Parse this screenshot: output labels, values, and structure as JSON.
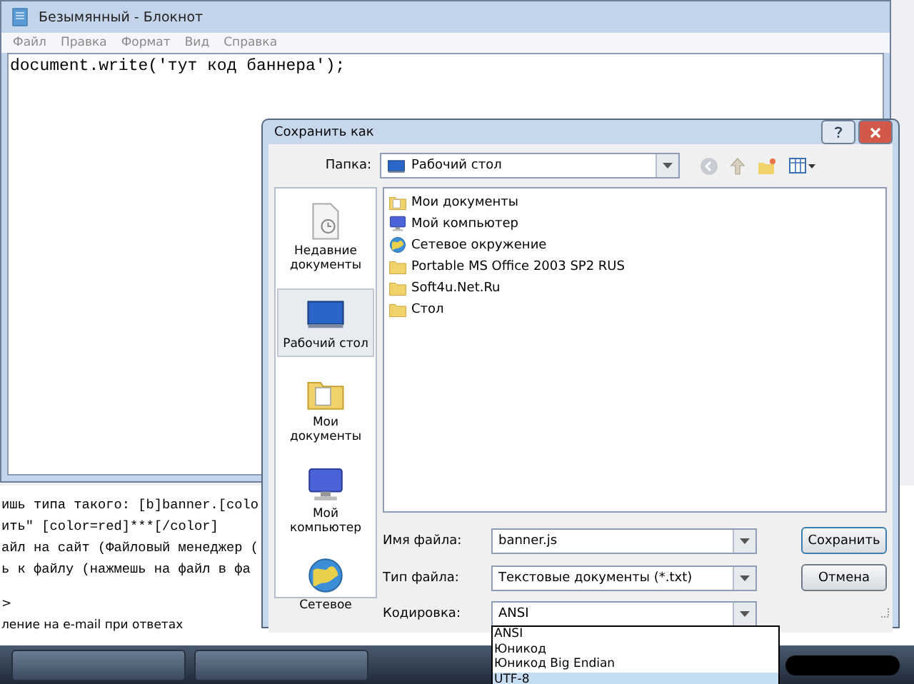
{
  "notepad": {
    "title": "Безымянный - Блокнот",
    "menu": [
      "Файл",
      "Правка",
      "Формат",
      "Вид",
      "Справка"
    ],
    "text": "document.write('тут код баннера');"
  },
  "background_page": {
    "lines": [
      {
        "text": "ишь типа такого: [b]banner.[colo",
        "kind": "code"
      },
      {
        "text": "ить\" [color=red]***[/color]",
        "kind": "code"
      },
      {
        "text": "айл на сайт (Файловый менеджер (",
        "kind": "code"
      },
      {
        "text": "ь к файлу (нажмешь на файл в фа",
        "kind": "code"
      },
      {
        "text": ">",
        "kind": "plain"
      },
      {
        "text": "ление на e-mail при ответах",
        "kind": "plain"
      }
    ]
  },
  "dialog": {
    "title": "Сохранить как",
    "folder_label": "Папка:",
    "folder": "Рабочий стол",
    "places": [
      {
        "label": "Недавние документы",
        "kind": "recent",
        "selected": false
      },
      {
        "label": "Рабочий стол",
        "kind": "desktop",
        "selected": true
      },
      {
        "label": "Мои документы",
        "kind": "documents",
        "selected": false
      },
      {
        "label": "Мой компьютер",
        "kind": "computer",
        "selected": false
      },
      {
        "label": "Сетевое",
        "kind": "network",
        "selected": false
      }
    ],
    "files": [
      {
        "name": "Мои документы",
        "kind": "documents"
      },
      {
        "name": "Мой компьютер",
        "kind": "computer"
      },
      {
        "name": "Сетевое окружение",
        "kind": "network"
      },
      {
        "name": "Portable MS Office 2003 SP2 RUS",
        "kind": "folder"
      },
      {
        "name": "Soft4u.Net.Ru",
        "kind": "folder"
      },
      {
        "name": "Стол",
        "kind": "folder"
      }
    ],
    "filename_label": "Имя файла:",
    "filename": "banner.js",
    "filetype_label": "Тип файла:",
    "filetype": "Текстовые документы (*.txt)",
    "encoding_label": "Кодировка:",
    "encoding": "ANSI",
    "encoding_options": [
      {
        "label": "ANSI",
        "selected": false
      },
      {
        "label": "Юникод",
        "selected": false
      },
      {
        "label": "Юникод Big Endian",
        "selected": false
      },
      {
        "label": "UTF-8",
        "selected": true
      }
    ],
    "buttons": [
      "Сохранить",
      "Отмена"
    ]
  }
}
